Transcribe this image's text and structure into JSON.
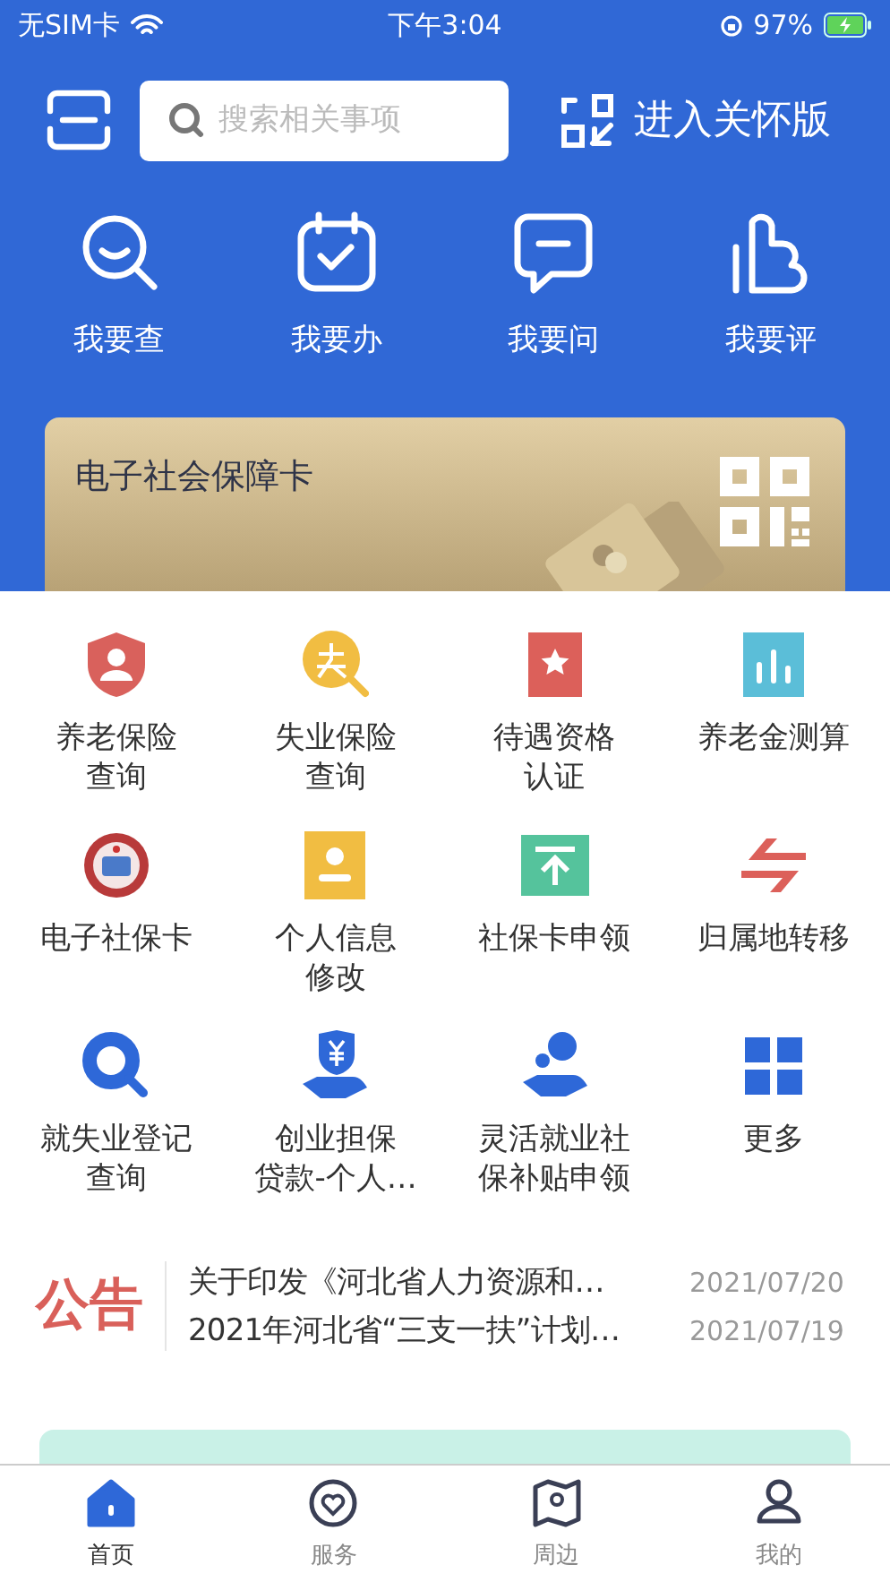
{
  "status_bar": {
    "carrier": "无SIM卡",
    "time": "下午3:04",
    "battery": "97%"
  },
  "header": {
    "search": {
      "placeholder": "搜索相关事项"
    },
    "care_mode": "进入关怀版"
  },
  "quick_actions": [
    {
      "kind": "search",
      "label": "我要查"
    },
    {
      "kind": "calendar",
      "label": "我要办"
    },
    {
      "kind": "chat",
      "label": "我要问"
    },
    {
      "kind": "thumb",
      "label": "我要评"
    }
  ],
  "card": {
    "title": "电子社会保障卡"
  },
  "services": [
    {
      "kind": "shield",
      "lines": [
        "养老保险",
        "查询"
      ]
    },
    {
      "kind": "lost",
      "lines": [
        "失业保险",
        "查询"
      ]
    },
    {
      "kind": "award",
      "lines": [
        "待遇资格",
        "认证"
      ]
    },
    {
      "kind": "chart",
      "lines": [
        "养老金测算"
      ]
    },
    {
      "kind": "seal",
      "lines": [
        "电子社保卡"
      ]
    },
    {
      "kind": "id",
      "lines": [
        "个人信息",
        "修改"
      ]
    },
    {
      "kind": "upload",
      "lines": [
        "社保卡申领"
      ]
    },
    {
      "kind": "transfer",
      "lines": [
        "归属地转移"
      ]
    },
    {
      "kind": "search",
      "lines": [
        "就失业登记",
        "查询"
      ]
    },
    {
      "kind": "yen",
      "lines": [
        "创业担保",
        "贷款-个人…"
      ]
    },
    {
      "kind": "coin",
      "lines": [
        "灵活就业社",
        "保补贴申领"
      ]
    },
    {
      "kind": "grid",
      "lines": [
        "更多"
      ]
    }
  ],
  "notices": {
    "label": "公告",
    "items": [
      {
        "title": "关于印发《河北省人力资源和…",
        "date": "2021/07/20"
      },
      {
        "title": "2021年河北省“三支一扶”计划…",
        "date": "2021/07/19"
      }
    ]
  },
  "tab_bar": [
    {
      "kind": "home",
      "label": "首页",
      "selected": true
    },
    {
      "kind": "service",
      "label": "服务",
      "selected": false
    },
    {
      "kind": "nearby",
      "label": "周边",
      "selected": false
    },
    {
      "kind": "me",
      "label": "我的",
      "selected": false
    }
  ]
}
